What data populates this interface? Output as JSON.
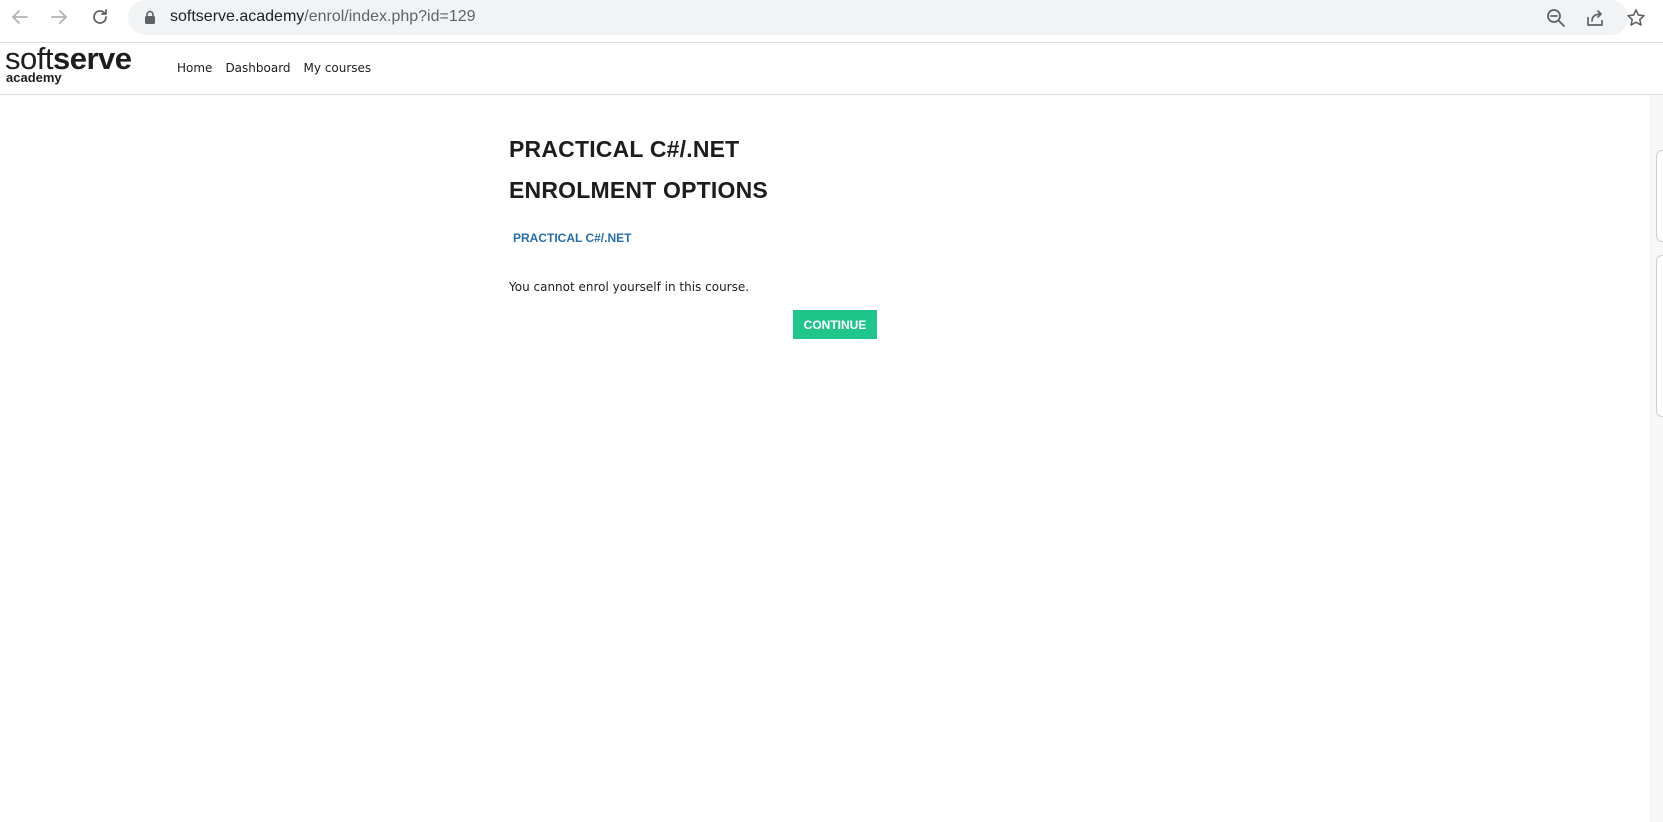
{
  "browser": {
    "url_host": "softserve.academy",
    "url_path": "/enrol/index.php?id=129",
    "icons": [
      "back-arrow-icon",
      "forward-arrow-icon",
      "reload-icon",
      "lock-icon",
      "zoom-out-icon",
      "share-icon",
      "bookmark-star-icon"
    ]
  },
  "site": {
    "logo_soft": "soft",
    "logo_serve": "serve",
    "logo_sub": "academy",
    "nav": [
      {
        "label": "Home"
      },
      {
        "label": "Dashboard"
      },
      {
        "label": "My courses"
      }
    ]
  },
  "main": {
    "course_title": "PRACTICAL C#/.NET",
    "section_title": "ENROLMENT OPTIONS",
    "course_link": "PRACTICAL C#/.NET",
    "notice": "You cannot enrol yourself in this course.",
    "continue_label": "CONTINUE"
  },
  "colors": {
    "accent_button": "#1fc58a",
    "link": "#2a6ea6",
    "text": "#1d1d1b"
  }
}
